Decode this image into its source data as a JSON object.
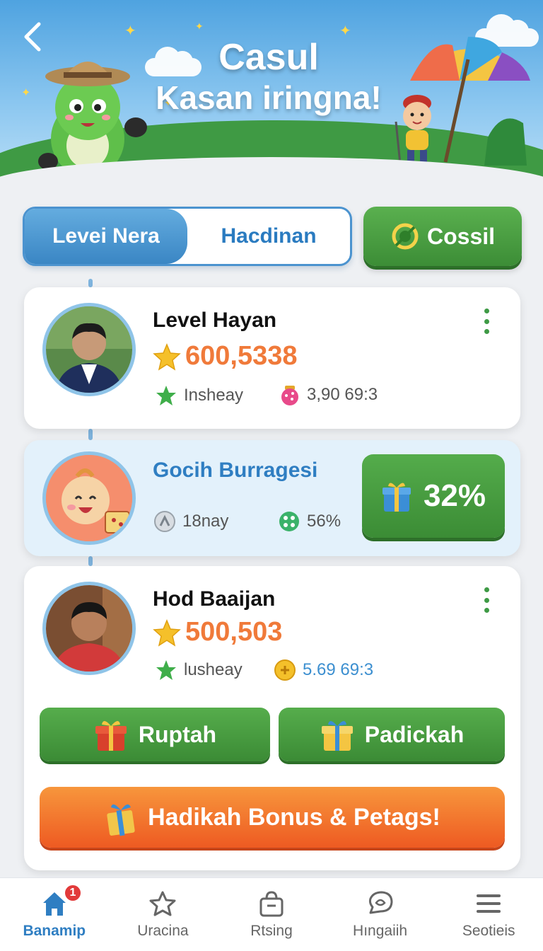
{
  "header": {
    "title_line1": "Casul",
    "title_line2": "Kasan iringna!"
  },
  "segment": {
    "tab1": "Levei Nera",
    "tab2": "Hacdinan"
  },
  "cossil_button": "Cossil",
  "cards": [
    {
      "name": "Level Hayan",
      "score": "600,5338",
      "meta_left": "Insheay",
      "meta_right": "3,90 69:3"
    },
    {
      "name": "Gocih Burragesi",
      "meta_left": "18nay",
      "meta_right": "56%",
      "percent": "32%"
    },
    {
      "name": "Hod Baaijan",
      "score": "500,503",
      "meta_left": "lusheay",
      "meta_right": "5.69 69:3",
      "button_left": "Ruptah",
      "button_right": "Padickah",
      "bonus_button": "Hadikah Bonus & Petags!"
    }
  ],
  "bottom_nav": {
    "items": [
      {
        "label": "Banamip",
        "icon": "home-icon",
        "active": true,
        "badge": "1"
      },
      {
        "label": "Uracina",
        "icon": "star-icon"
      },
      {
        "label": "Rtsing",
        "icon": "bag-icon"
      },
      {
        "label": "Hıngaiih",
        "icon": "chat-icon"
      },
      {
        "label": "Seotiеis",
        "icon": "menu-icon"
      }
    ]
  },
  "colors": {
    "accent_blue": "#3a86c4",
    "green": "#3c8d36",
    "orange": "#f07a3a"
  }
}
